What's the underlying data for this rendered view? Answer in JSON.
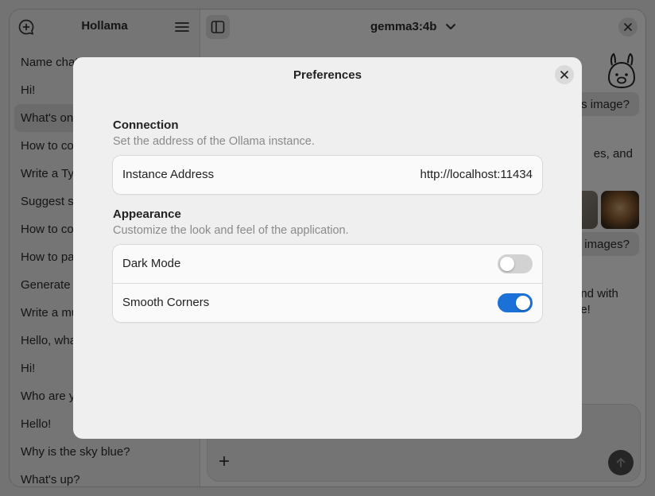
{
  "sidebar": {
    "title": "Hollama",
    "chats": [
      {
        "label": "Name chat"
      },
      {
        "label": "Hi!"
      },
      {
        "label": "What's on"
      },
      {
        "label": "How to co"
      },
      {
        "label": "Write a Ty"
      },
      {
        "label": "Suggest s"
      },
      {
        "label": "How to co"
      },
      {
        "label": "How to pa"
      },
      {
        "label": "Generate a"
      },
      {
        "label": "Write a mu"
      },
      {
        "label": "Hello, wha"
      },
      {
        "label": "Hi!"
      },
      {
        "label": "Who are y"
      },
      {
        "label": "Hello!"
      },
      {
        "label": "Why is the sky blue?"
      },
      {
        "label": "What's up?"
      }
    ]
  },
  "header": {
    "model": "gemma3:4b"
  },
  "conversation": {
    "bubble1": "is image?",
    "text1": "es, and",
    "bubble2": "e images?",
    "text2_line1": "and with",
    "text2_line2": "ne!"
  },
  "composer": {
    "add_label": "+"
  },
  "dialog": {
    "title": "Preferences",
    "connection": {
      "title": "Connection",
      "subtitle": "Set the address of the Ollama instance.",
      "instance_label": "Instance Address",
      "instance_value": "http://localhost:11434"
    },
    "appearance": {
      "title": "Appearance",
      "subtitle": "Customize the look and feel of the application.",
      "dark_mode_label": "Dark Mode",
      "dark_mode_on": false,
      "smooth_corners_label": "Smooth Corners",
      "smooth_corners_on": true
    }
  },
  "colors": {
    "accent": "#1c71d8",
    "overlay": "rgba(0,0,0,0.5)"
  }
}
